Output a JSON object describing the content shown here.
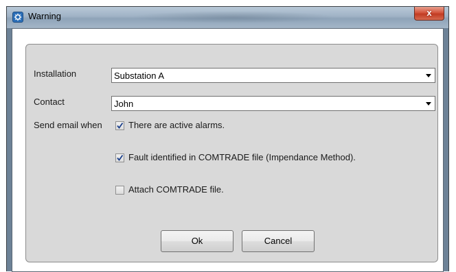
{
  "window": {
    "title": "Warning",
    "close_label": "x"
  },
  "form": {
    "installation": {
      "label": "Installation",
      "value": "Substation A"
    },
    "contact": {
      "label": "Contact",
      "value": "John"
    },
    "send_email_label": "Send email when",
    "options": [
      {
        "label": "There are active alarms.",
        "checked": true
      },
      {
        "label": "Fault identified in COMTRADE file (Impendance Method).",
        "checked": true
      },
      {
        "label": "Attach COMTRADE file.",
        "checked": false
      }
    ]
  },
  "buttons": {
    "ok": "Ok",
    "cancel": "Cancel"
  },
  "icons": {
    "app": "app-logo-icon",
    "close": "close-icon",
    "dropdown": "chevron-down-icon",
    "check": "checkmark-icon"
  }
}
